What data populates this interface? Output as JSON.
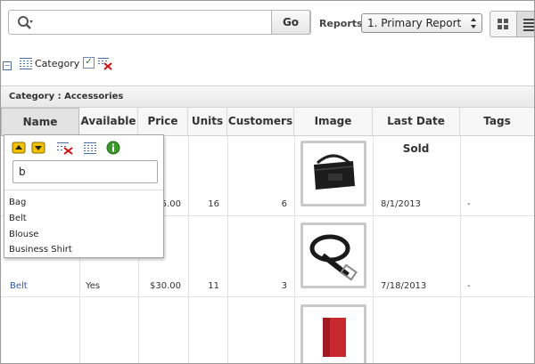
{
  "toolbar": {
    "search_value": "",
    "go_label": "Go",
    "reports_label": "Reports",
    "report_selected": "1. Primary Report",
    "view_icons": [
      "grid-view-icon",
      "list-view-icon"
    ]
  },
  "filter": {
    "category_label": "Category"
  },
  "group": {
    "title": "Category : Accessories"
  },
  "columns": [
    "Name",
    "Available",
    "Price",
    "Units",
    "Customers",
    "Image",
    "Last Date Sold",
    "Tags"
  ],
  "rows": [
    {
      "name": "",
      "available": "",
      "price": "5.00",
      "units": "16",
      "customers": "6",
      "image": "bag",
      "last_sold": "8/1/2013",
      "tags": "-"
    },
    {
      "name": "Belt",
      "available": "Yes",
      "price": "$30.00",
      "units": "11",
      "customers": "3",
      "image": "belt",
      "last_sold": "7/18/2013",
      "tags": "-"
    },
    {
      "name": "",
      "available": "",
      "price": "",
      "units": "",
      "customers": "",
      "image": "wallet",
      "last_sold": "",
      "tags": ""
    }
  ],
  "popup": {
    "input_value": "b",
    "options": [
      "Bag",
      "Belt",
      "Blouse",
      "Business Shirt"
    ],
    "icons": [
      "sort-ascending-icon",
      "sort-descending-icon",
      "remove-filter-icon",
      "group-by-icon",
      "info-icon"
    ]
  },
  "colors": {
    "link": "#2858a8",
    "header_bg": "#f7f7f7",
    "accent_yellow": "#f2c200",
    "info_green": "#3a9a2a"
  }
}
